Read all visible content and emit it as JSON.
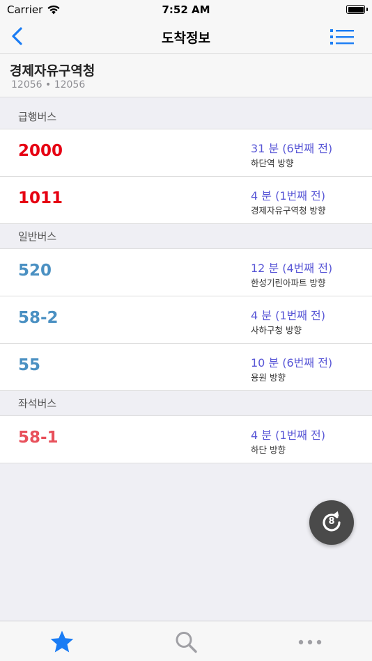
{
  "status_bar": {
    "carrier": "Carrier",
    "time": "7:52 AM"
  },
  "nav": {
    "title": "도착정보",
    "back_icon": "chevron-left-icon",
    "menu_icon": "list-icon"
  },
  "stop": {
    "name": "경제자유구역청",
    "code": "12056 • 12056"
  },
  "sections": [
    {
      "title": "급행버스",
      "routes": [
        {
          "number": "2000",
          "arrival": "31 분 (6번째 전)",
          "direction": "하단역 방향",
          "color": "#e60012"
        },
        {
          "number": "1011",
          "arrival": "4 분 (1번째 전)",
          "direction": "경제자유구역청 방향",
          "color": "#e60012"
        }
      ]
    },
    {
      "title": "일반버스",
      "routes": [
        {
          "number": "520",
          "arrival": "12 분 (4번째 전)",
          "direction": "한성기린아파트 방향",
          "color": "#4a90c2"
        },
        {
          "number": "58-2",
          "arrival": "4 분 (1번째 전)",
          "direction": "사하구청 방향",
          "color": "#4a90c2"
        },
        {
          "number": "55",
          "arrival": "10 분 (6번째 전)",
          "direction": "용원 방향",
          "color": "#4a90c2"
        }
      ]
    },
    {
      "title": "좌석버스",
      "routes": [
        {
          "number": "58-1",
          "arrival": "4 분 (1번째 전)",
          "direction": "하단 방향",
          "color": "#e8505b"
        }
      ]
    }
  ],
  "refresh": {
    "count": "8",
    "icon": "refresh-icon"
  },
  "tabs": [
    {
      "icon": "star-icon",
      "active": true
    },
    {
      "icon": "search-icon",
      "active": false
    },
    {
      "icon": "more-icon",
      "active": false
    }
  ],
  "colors": {
    "accent": "#1a7cf4",
    "arrival": "#5856d6",
    "inactive": "#a0a0a5"
  }
}
